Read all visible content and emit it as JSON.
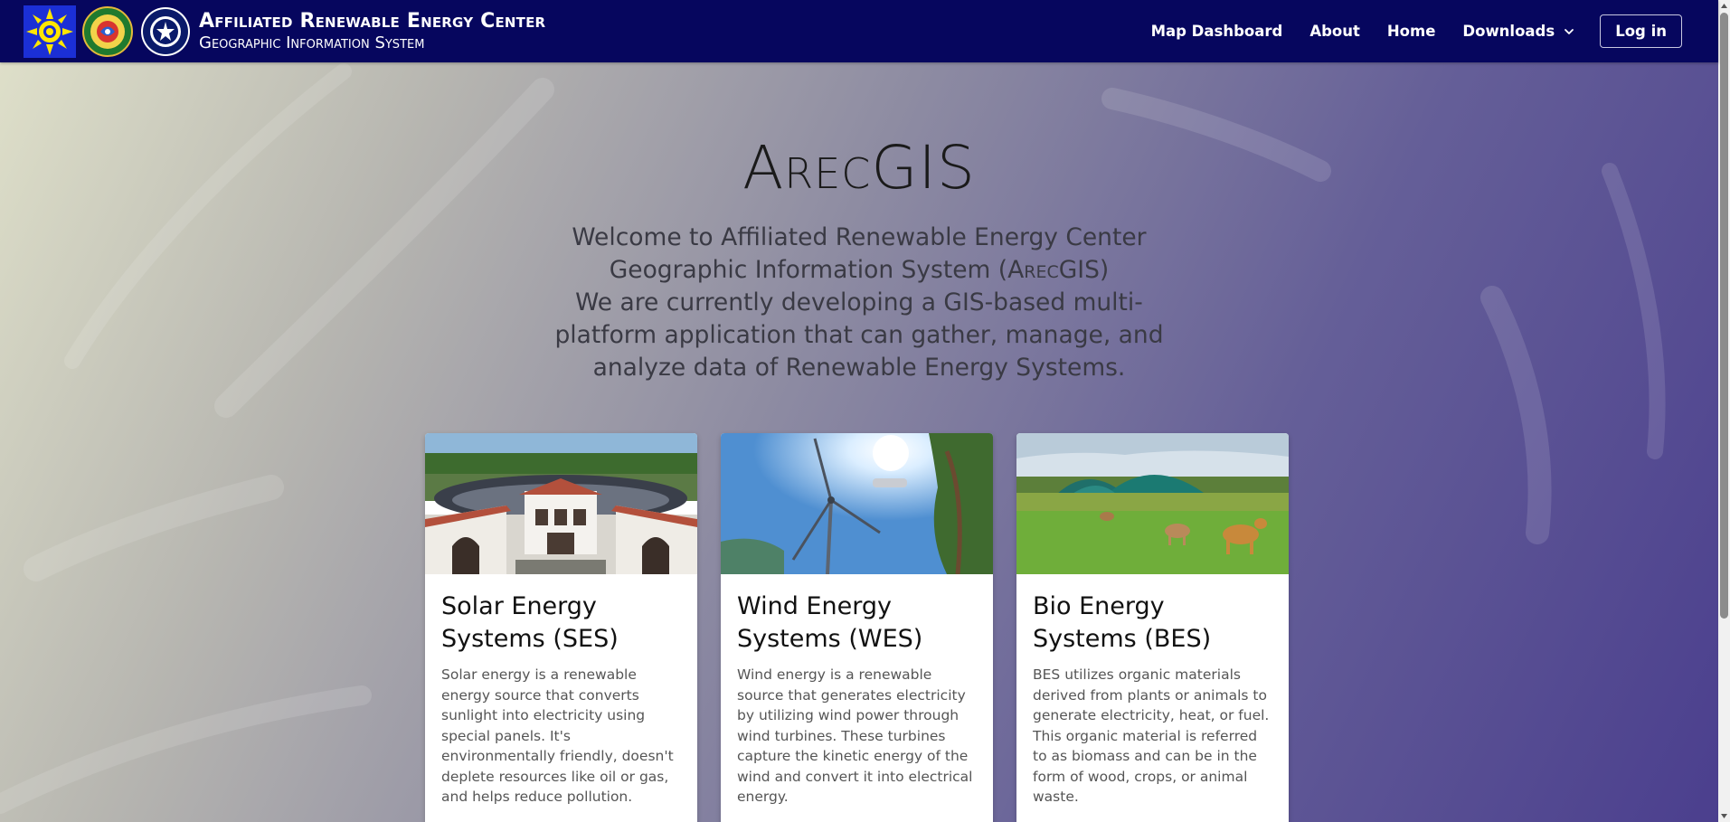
{
  "header": {
    "title": "Affiliated Renewable Energy Center",
    "subtitle": "Geographic Information System",
    "logos": [
      "provincial-seal-icon",
      "university-seal-icon",
      "center-seal-icon"
    ]
  },
  "nav": {
    "items": [
      {
        "label": "Map Dashboard"
      },
      {
        "label": "About"
      },
      {
        "label": "Home"
      },
      {
        "label": "Downloads"
      }
    ],
    "login": "Log in"
  },
  "hero": {
    "title": "ArecGIS",
    "welcome_line1": "Welcome to Affiliated Renewable Energy Center",
    "welcome_line2_pre": "Geographic Information System (",
    "welcome_line2_abbr": "ArecGIS",
    "welcome_line2_post": ")",
    "description": "We are currently developing a GIS-based multi-platform application that can gather, manage, and analyze data of Renewable Energy Systems."
  },
  "cards": [
    {
      "title": "Solar Energy Systems (SES)",
      "text": "Solar energy is a renewable energy source that converts sunlight into electricity using special panels. It's environmentally friendly, doesn't deplete resources like oil or gas, and helps reduce pollution."
    },
    {
      "title": "Wind Energy Systems (WES)",
      "text": "Wind energy is a renewable source that generates electricity by utilizing wind power through wind turbines. These turbines capture the kinetic energy of the wind and convert it into electrical energy."
    },
    {
      "title": "Bio Energy Systems (BES)",
      "text": "BES utilizes organic materials derived from plants or animals to generate electricity, heat, or fuel. This organic material is referred to as biomass and can be in the form of wood, crops, or animal waste."
    }
  ],
  "colors": {
    "navbar": "#06065e",
    "logo_accent": "#ffe600"
  }
}
